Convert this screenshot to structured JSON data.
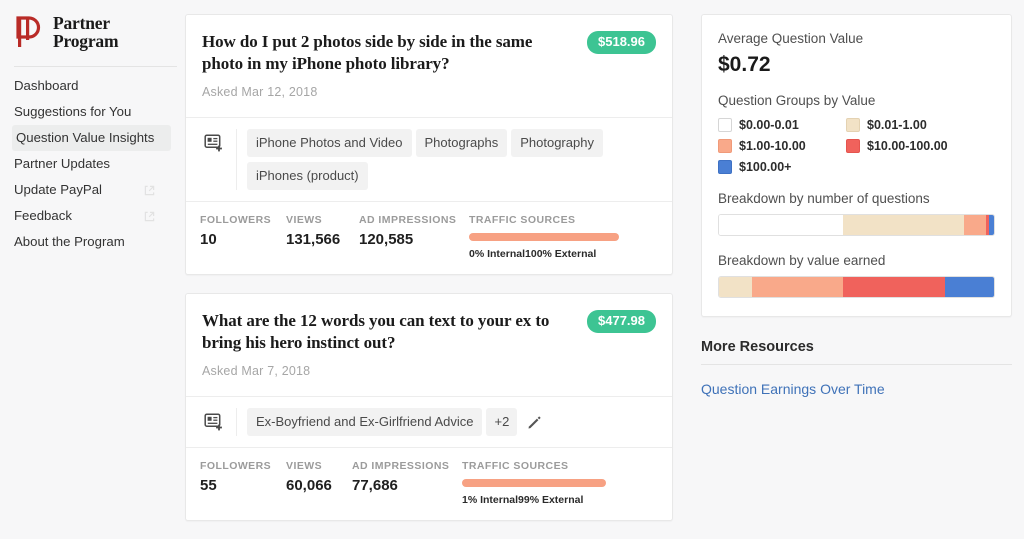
{
  "brand": {
    "line1": "Partner",
    "line2": "Program",
    "logo_color": "#b92b27",
    "logo_icon": "quora-p-logo"
  },
  "sidebar": {
    "items": [
      {
        "label": "Dashboard",
        "active": false,
        "external": false
      },
      {
        "label": "Suggestions for You",
        "active": false,
        "external": false
      },
      {
        "label": "Question Value Insights",
        "active": true,
        "external": false
      },
      {
        "label": "Partner Updates",
        "active": false,
        "external": false
      },
      {
        "label": "Update PayPal",
        "active": false,
        "external": true
      },
      {
        "label": "Feedback",
        "active": false,
        "external": true
      },
      {
        "label": "About the Program",
        "active": false,
        "external": false
      }
    ]
  },
  "questions": [
    {
      "title": "How do I put 2 photos side by side in the same photo in my iPhone photo library?",
      "asked": "Asked Mar 12, 2018",
      "earnings": "$518.96",
      "topics": [
        "iPhone Photos and Video",
        "Photographs",
        "Photography",
        "iPhones (product)"
      ],
      "extra_topics": "",
      "has_edit": false,
      "stats": {
        "followers_label": "FOLLOWERS",
        "followers_value": "10",
        "views_label": "VIEWS",
        "views_value": "131,566",
        "impressions_label": "AD IMPRESSIONS",
        "impressions_value": "120,585",
        "traffic_label": "TRAFFIC SOURCES",
        "traffic_internal": "0% Internal",
        "traffic_external": "100% External",
        "traffic_bar_width_pct": 100
      }
    },
    {
      "title": "What are the 12 words you can text to your ex to bring his hero instinct out?",
      "asked": "Asked Mar 7, 2018",
      "earnings": "$477.98",
      "topics": [
        "Ex-Boyfriend and Ex-Girlfriend Advice"
      ],
      "extra_topics": "+2",
      "has_edit": true,
      "stats": {
        "followers_label": "FOLLOWERS",
        "followers_value": "55",
        "views_label": "VIEWS",
        "views_value": "60,066",
        "impressions_label": "AD IMPRESSIONS",
        "impressions_value": "77,686",
        "traffic_label": "TRAFFIC SOURCES",
        "traffic_internal": "1% Internal",
        "traffic_external": "99% External",
        "traffic_bar_width_pct": 96
      }
    }
  ],
  "insights": {
    "avg_label": "Average Question Value",
    "avg_value": "$0.72",
    "groups_label": "Question Groups by Value",
    "legend": [
      {
        "label": "$0.00-0.01",
        "color": "#ffffff"
      },
      {
        "label": "$0.01-1.00",
        "color": "#f2e2c6"
      },
      {
        "label": "$1.00-10.00",
        "color": "#f9a98a"
      },
      {
        "label": "$10.00-100.00",
        "color": "#f0625c"
      },
      {
        "label": "$100.00+",
        "color": "#4a7fd4"
      }
    ],
    "bar1_label": "Breakdown by number of questions",
    "bar2_label": "Breakdown by value earned"
  },
  "chart_data": [
    {
      "type": "bar",
      "title": "Breakdown by number of questions",
      "orientation": "horizontal-stacked",
      "categories": [
        "$0.00-0.01",
        "$0.01-1.00",
        "$1.00-10.00",
        "$10.00-100.00",
        "$100.00+"
      ],
      "values": [
        45,
        44,
        8,
        1.3,
        1.7
      ],
      "colors": [
        "#ffffff",
        "#f2e2c6",
        "#f9a98a",
        "#f0625c",
        "#4a7fd4"
      ],
      "unit": "percent",
      "xlabel": "",
      "ylabel": "",
      "legend": "above"
    },
    {
      "type": "bar",
      "title": "Breakdown by value earned",
      "orientation": "horizontal-stacked",
      "categories": [
        "$0.00-0.01",
        "$0.01-1.00",
        "$1.00-10.00",
        "$10.00-100.00",
        "$100.00+"
      ],
      "values": [
        0,
        12,
        33,
        37,
        18
      ],
      "colors": [
        "#ffffff",
        "#f2e2c6",
        "#f9a98a",
        "#f0625c",
        "#4a7fd4"
      ],
      "unit": "percent",
      "xlabel": "",
      "ylabel": "",
      "legend": "above"
    }
  ],
  "more_resources": {
    "title": "More Resources",
    "links": [
      {
        "label": "Question Earnings Over Time"
      }
    ]
  }
}
